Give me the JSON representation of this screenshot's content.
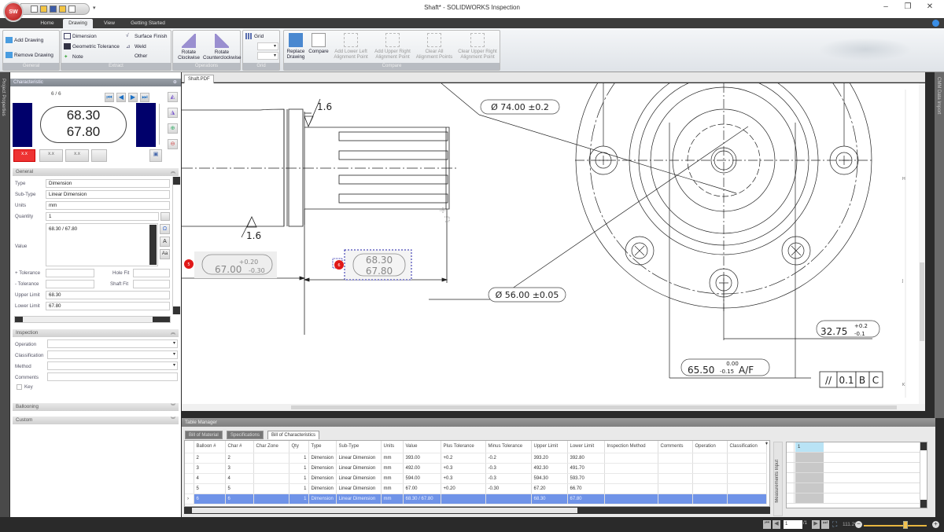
{
  "window": {
    "title": "Shaft* - SOLIDWORKS Inspection",
    "logo_text": "SW",
    "controls": {
      "minimize": "–",
      "restore": "❐",
      "close": "✕"
    }
  },
  "ribbon_tabs": [
    {
      "label": "Home",
      "active": false
    },
    {
      "label": "Drawing",
      "active": true
    },
    {
      "label": "View",
      "active": false
    },
    {
      "label": "Getting Started",
      "active": false
    }
  ],
  "ribbon": {
    "general": {
      "label": "General",
      "add_drawing": "Add Drawing",
      "remove_drawing": "Remove Drawing"
    },
    "extract": {
      "label": "Extract",
      "dimension": "Dimension",
      "geometric_tolerance": "Geometric Tolerance",
      "note": "Note",
      "surface_finish": "Surface Finish",
      "weld": "Weld",
      "other": "Other"
    },
    "operations": {
      "label": "Operations",
      "rotate_cw": "Rotate Clockwise",
      "rotate_ccw": "Rotate Counterclockwise"
    },
    "grid": {
      "label": "Grid",
      "grid": "Grid"
    },
    "compare": {
      "label": "Compare",
      "replace_drawing": "Replace Drawing",
      "compare": "Compare",
      "add_lower_left": "Add Lower Left Alignment Point",
      "add_upper_right": "Add Upper Right Alignment Point",
      "clear_all": "Clear All Alignment Points",
      "clear_upper_right": "Clear Upper Right Alignment Point"
    }
  },
  "side_strip": {
    "left": "Project Properties",
    "right": "CMM Data Import"
  },
  "characteristic": {
    "header": "Characteristic",
    "counter": "6 / 6",
    "upper_value": "68.30",
    "lower_value": "67.80"
  },
  "general": {
    "header": "General",
    "fields": {
      "type": {
        "label": "Type",
        "value": "Dimension"
      },
      "subtype": {
        "label": "Sub-Type",
        "value": "Linear Dimension"
      },
      "units": {
        "label": "Units",
        "value": "mm"
      },
      "quantity": {
        "label": "Quantity",
        "value": "1"
      },
      "value": {
        "label": "Value",
        "value": "68.30 / 67.80"
      },
      "plus_tol": {
        "label": "+ Tolerance",
        "value": ""
      },
      "minus_tol": {
        "label": "- Tolerance",
        "value": ""
      },
      "hole_fit": {
        "label": "Hole Fit",
        "value": ""
      },
      "shaft_fit": {
        "label": "Shaft Fit",
        "value": ""
      },
      "upper_limit": {
        "label": "Upper Limit",
        "value": "68.30"
      },
      "lower_limit": {
        "label": "Lower Limit",
        "value": "67.80"
      }
    }
  },
  "inspection": {
    "header": "Inspection",
    "operation": {
      "label": "Operation",
      "value": ""
    },
    "classification": {
      "label": "Classification",
      "value": ""
    },
    "method": {
      "label": "Method",
      "value": ""
    },
    "comments": {
      "label": "Comments",
      "value": ""
    },
    "key": {
      "label": "Key",
      "checked": false
    }
  },
  "ballooning": {
    "header": "Ballooning"
  },
  "custom": {
    "header": "Custom"
  },
  "document": {
    "tab": "Shaft.PDF",
    "annotations": {
      "surface_top": "1.6",
      "surface_bottom": "1.6",
      "dim5_plus": "+0.20",
      "dim5_main": "67.00",
      "dim5_minus": "-0.30",
      "balloon5": "5",
      "balloon6": "6",
      "dim6_upper": "68.30",
      "dim6_lower": "67.80",
      "dia74": "Ø 74.00 ±0.2",
      "dia56": "Ø 56.00 ±0.05",
      "dim3275_main": "32.75",
      "dim3275_plus": "+0.2",
      "dim3275_minus": "-0.1",
      "dim6550_top": "0.00",
      "dim6550_main": "65.50",
      "dim6550_minus": "-0.15",
      "dim6550_suffix": "A/F",
      "fcf": [
        "//",
        "0.1",
        "B",
        "C"
      ],
      "zone_h": "H",
      "zone_j": "J",
      "zone_k": "K"
    }
  },
  "table_manager": {
    "header": "Table Manager",
    "tabs": [
      {
        "label": "Bill of Material",
        "active": false
      },
      {
        "label": "Specifications",
        "active": false
      },
      {
        "label": "Bill of Characteristics",
        "active": true
      }
    ],
    "columns": [
      "Balloon #",
      "Char #",
      "Char Zone",
      "Qty",
      "Type",
      "Sub-Type",
      "Units",
      "Value",
      "Plus Tolerance",
      "Minus Tolerance",
      "Upper Limit",
      "Lower Limit",
      "Inspection Method",
      "Comments",
      "Operation",
      "Classification"
    ],
    "rows": [
      [
        "2",
        "2",
        "",
        "1",
        "Dimension",
        "Linear Dimension",
        "mm",
        "393.00",
        "+0.2",
        "-0.2",
        "393.20",
        "392.80",
        "",
        "",
        "",
        ""
      ],
      [
        "3",
        "3",
        "",
        "1",
        "Dimension",
        "Linear Dimension",
        "mm",
        "492.00",
        "+0.3",
        "-0.3",
        "492.30",
        "491.70",
        "",
        "",
        "",
        ""
      ],
      [
        "4",
        "4",
        "",
        "1",
        "Dimension",
        "Linear Dimension",
        "mm",
        "594.00",
        "+0.3",
        "-0.3",
        "594.30",
        "593.70",
        "",
        "",
        "",
        ""
      ],
      [
        "5",
        "5",
        "",
        "1",
        "Dimension",
        "Linear Dimension",
        "mm",
        "67.00",
        "+0.20",
        "-0.30",
        "67.20",
        "66.70",
        "",
        "",
        "",
        ""
      ],
      [
        "6",
        "6",
        "",
        "1",
        "Dimension",
        "Linear Dimension",
        "mm",
        "68.30 / 67.80",
        "",
        "",
        "68.30",
        "67.80",
        "",
        "",
        "",
        ""
      ]
    ],
    "selected_row": 4,
    "current_row_marker": "›",
    "measurements_label": "Measurements Input",
    "measurements": [
      "1",
      "",
      "",
      "",
      "",
      ""
    ]
  },
  "statusbar": {
    "page": "1",
    "page_total": "/1",
    "zoom": "111.2%"
  }
}
